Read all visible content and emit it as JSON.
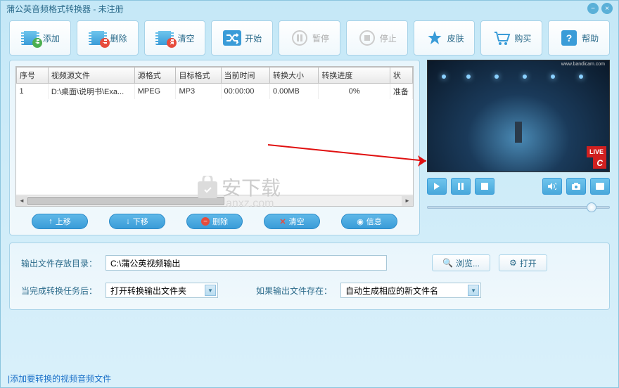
{
  "window": {
    "title": "蒲公英音频格式转换器 - 未注册"
  },
  "toolbar": {
    "add": "添加",
    "delete": "删除",
    "clear": "清空",
    "start": "开始",
    "pause": "暂停",
    "stop": "停止",
    "skin": "皮肤",
    "buy": "购买",
    "help": "帮助"
  },
  "table": {
    "headers": {
      "index": "序号",
      "source": "视频源文件",
      "srcfmt": "源格式",
      "tgtfmt": "目标格式",
      "time": "当前时间",
      "size": "转换大小",
      "progress": "转换进度",
      "status": "状"
    },
    "rows": [
      {
        "index": "1",
        "source": "D:\\桌面\\说明书\\Exa...",
        "srcfmt": "MPEG",
        "tgtfmt": "MP3",
        "time": "00:00:00",
        "size": "0.00MB",
        "progress": "0%",
        "status": "准备"
      }
    ]
  },
  "list_actions": {
    "up": "上移",
    "down": "下移",
    "delete": "删除",
    "clear": "清空",
    "info": "信息"
  },
  "preview": {
    "url": "www.bandicam.com",
    "live": "LIVE",
    "logo": "C"
  },
  "output": {
    "dir_label": "输出文件存放目录：",
    "dir_value": "C:\\蒲公英视频输出",
    "browse": "浏览...",
    "open": "打开",
    "after_label": "当完成转换任务后：",
    "after_value": "打开转换输出文件夹",
    "exist_label": "如果输出文件存在：",
    "exist_value": "自动生成相应的新文件名"
  },
  "status": {
    "hint": "添加要转换的视频音频文件"
  }
}
